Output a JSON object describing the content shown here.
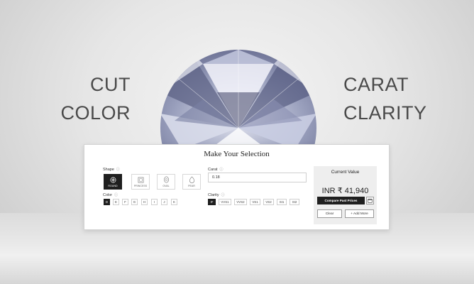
{
  "hero": {
    "words": {
      "cut": "CUT",
      "color": "COLOR",
      "carat": "CARAT",
      "clarity": "CLARITY"
    }
  },
  "panel": {
    "title": "Make Your Selection",
    "shape": {
      "label": "Shape",
      "options": [
        {
          "name": "ROUND",
          "selected": true
        },
        {
          "name": "PRINCESS",
          "selected": false
        },
        {
          "name": "OVAL",
          "selected": false
        },
        {
          "name": "PEAR",
          "selected": false
        }
      ]
    },
    "color": {
      "label": "Color",
      "options": [
        "D",
        "E",
        "F",
        "G",
        "H",
        "I",
        "J",
        "K"
      ],
      "selected": "D"
    },
    "carat": {
      "label": "Carat",
      "value": "0.18"
    },
    "clarity": {
      "label": "Clarity",
      "options": [
        "IF",
        "VVS1",
        "VVS2",
        "VS1",
        "VS2",
        "SI1",
        "SI2"
      ],
      "selected": "IF"
    },
    "info_icon": "info-icon",
    "current_value": {
      "title": "Current Value",
      "amount": "INR ₹ 41,940",
      "compare_label": "Compare Past Prices",
      "calendar_icon": "calendar-icon",
      "clear_label": "Clear",
      "add_more_label": "+ Add More"
    }
  },
  "colors": {
    "selected_bg": "#1f1f1f",
    "panel_bg": "#ffffff",
    "value_box_bg": "#eeeeee",
    "hero_text": "#4a4a4a"
  }
}
